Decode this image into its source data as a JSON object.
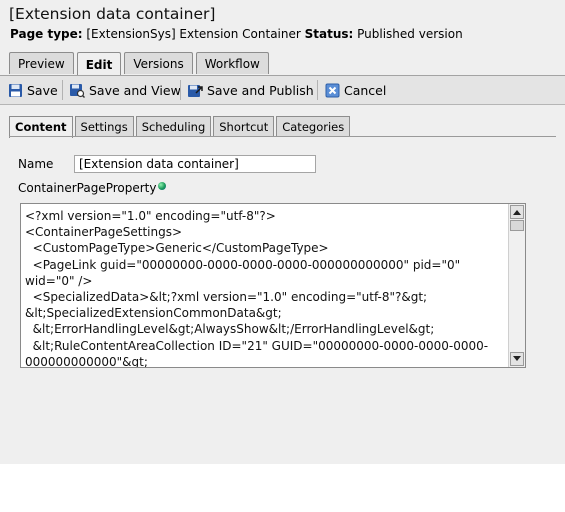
{
  "page": {
    "title": "[Extension data container]",
    "page_type_label": "Page type:",
    "page_type_value": " [ExtensionSys] Extension Container ",
    "status_label": "Status:",
    "status_value": " Published version"
  },
  "top_tabs": [
    "Preview",
    "Edit",
    "Versions",
    "Workflow"
  ],
  "toolbar": {
    "save": "Save",
    "save_and_view": "Save and View",
    "save_and_publish": "Save and Publish",
    "cancel": "Cancel"
  },
  "sub_tabs": [
    "Content",
    "Settings",
    "Scheduling",
    "Shortcut",
    "Categories"
  ],
  "form": {
    "name_label": "Name",
    "name_value": "[Extension data container]",
    "property_label": "ContainerPageProperty",
    "property_xml": "<?xml version=\"1.0\" encoding=\"utf-8\"?>\n<ContainerPageSettings>\n  <CustomPageType>Generic</CustomPageType>\n  <PageLink guid=\"00000000-0000-0000-0000-000000000000\" pid=\"0\" wid=\"0\" />\n  <SpecializedData>&lt;?xml version=\"1.0\" encoding=\"utf-8\"?&gt;\n&lt;SpecializedExtensionCommonData&gt;\n  &lt;ErrorHandlingLevel&gt;AlwaysShow&lt;/ErrorHandlingLevel&gt;\n  &lt;RuleContentAreaCollection ID=\"21\" GUID=\"00000000-0000-0000-0000-000000000000\"&gt;"
  },
  "icons": {
    "save": "floppy-disk-icon",
    "save_and_view": "floppy-view-icon",
    "save_and_publish": "publish-icon",
    "cancel": "cancel-icon",
    "property_info": "globe-icon"
  }
}
